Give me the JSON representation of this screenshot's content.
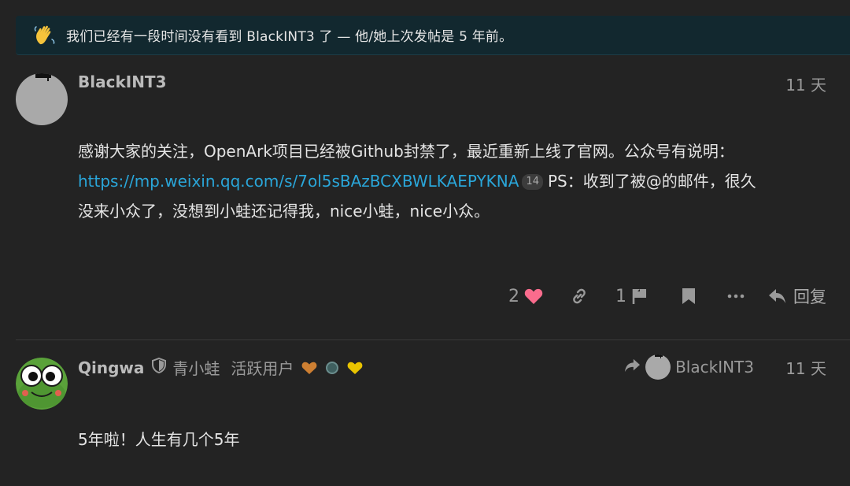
{
  "banner": {
    "icon": "waving-hand-icon",
    "text": "我们已经有一段时间没有看到 BlackINT3 了 — 他/她上次发帖是 5 年前。"
  },
  "posts": [
    {
      "username": "BlackINT3",
      "date": "11 天",
      "body_line1": "感谢大家的关注，OpenArk项目已经被Github封禁了，最近重新上线了官网。公众号有说明：",
      "link_text": "https://mp.weixin.qq.com/s/7ol5sBAzBCXBWLKAEPYKNA",
      "link_clicks": "14",
      "body_after_link": "PS：收到了被@的邮件，很久",
      "body_line3": "没来小众了，没想到小蛙还记得我，nice小蛙，nice小众。",
      "actions": {
        "like_count": "2",
        "flag_count": "1",
        "reply_label": "回复"
      }
    },
    {
      "username": "Qingwa",
      "title_name": "青小蛙",
      "user_title": "活跃用户",
      "badges": [
        "heart-badge-orange",
        "circle-badge-teal",
        "heart-badge-yellow"
      ],
      "reply_to_username": "BlackINT3",
      "date": "11 天",
      "body": "5年啦！人生有几个5年"
    }
  ],
  "colors": {
    "background": "#232323",
    "banner_bg": "#12282f",
    "link": "#2aa6d9",
    "like_heart": "#fa6c8d"
  }
}
